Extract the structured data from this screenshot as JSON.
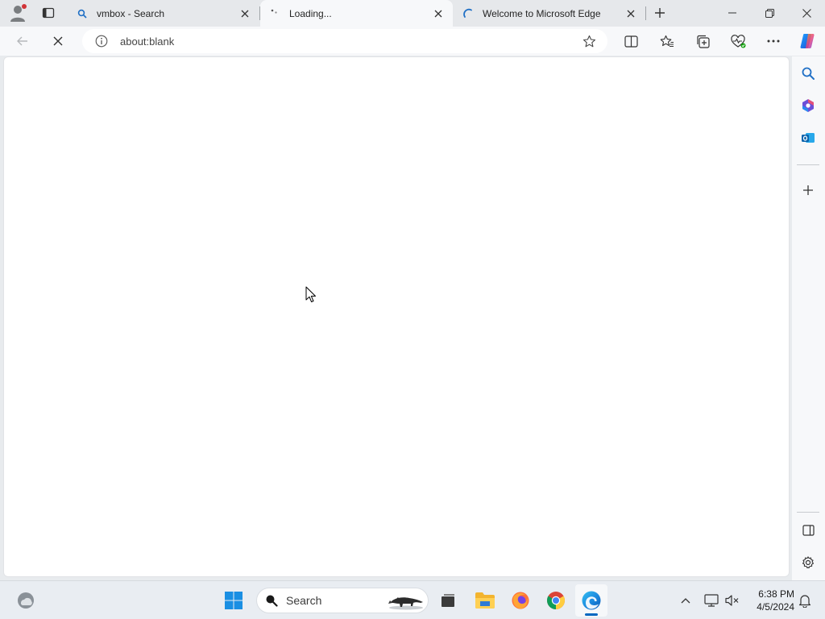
{
  "tabs": [
    {
      "label": "vmbox - Search",
      "favicon": "search-icon",
      "state": "inactive"
    },
    {
      "label": "Loading...",
      "favicon": "loading-icon",
      "state": "active"
    },
    {
      "label": "Welcome to Microsoft Edge",
      "favicon": "loading-icon",
      "state": "inactive"
    }
  ],
  "address_bar": {
    "url": "about:blank"
  },
  "taskbar": {
    "search_placeholder": "Search",
    "clock": {
      "time": "6:38 PM",
      "date": "4/5/2024"
    },
    "apps": [
      "widgets",
      "start",
      "search",
      "task-view",
      "file-explorer",
      "firefox",
      "chrome",
      "edge"
    ]
  },
  "colors": {
    "accent": "#0067c0",
    "tab_strip": "#e6e8eb",
    "toolbar": "#f7f8fa",
    "notification_dot": "#d13438"
  }
}
